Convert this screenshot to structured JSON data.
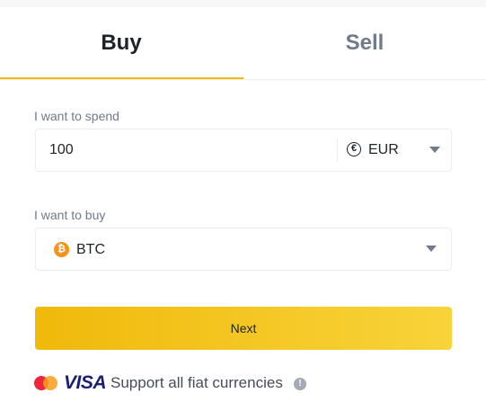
{
  "tabs": {
    "buy_label": "Buy",
    "sell_label": "Sell",
    "active": "Buy"
  },
  "spend": {
    "label": "I want to spend",
    "amount": "100",
    "currency_symbol": "€",
    "currency": "EUR"
  },
  "buy": {
    "label": "I want to buy",
    "coin_symbol": "₿",
    "coin": "BTC"
  },
  "actions": {
    "next_label": "Next"
  },
  "footer": {
    "visa_text": "VISA",
    "support_text": "Support all fiat currencies",
    "info_glyph": "!"
  },
  "colors": {
    "accent": "#f0b90b",
    "accent_end": "#f8d33a",
    "text_primary": "#1e2329",
    "text_secondary": "#707a8a",
    "btc_orange": "#f7931a",
    "visa_blue": "#1a1f71"
  },
  "icons": [
    "euro-icon",
    "caret-down-icon",
    "bitcoin-icon",
    "mastercard-icon",
    "visa-logo",
    "info-icon"
  ]
}
